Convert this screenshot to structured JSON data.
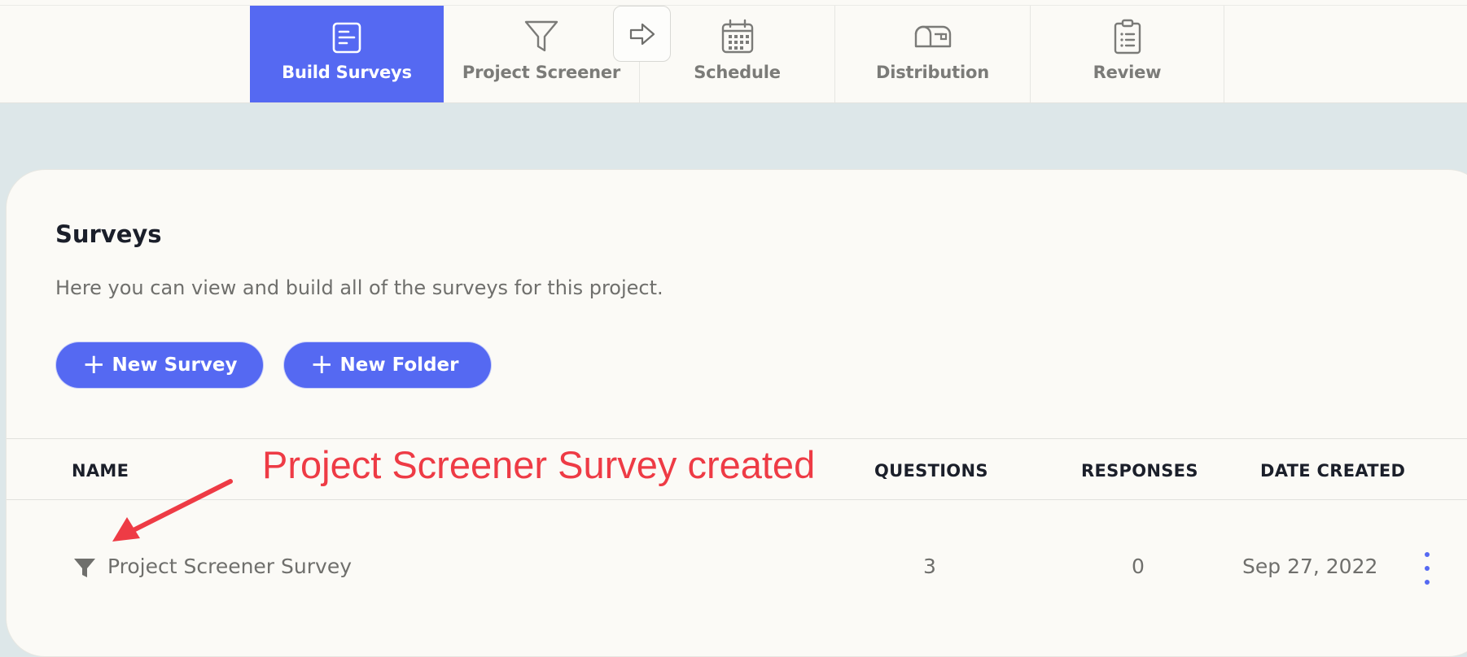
{
  "nav": {
    "tabs": [
      {
        "label": "Build Surveys",
        "icon": "document-icon",
        "active": true
      },
      {
        "label": "Project Screener",
        "icon": "filter-icon",
        "active": false
      },
      {
        "label": "Schedule",
        "icon": "calendar-icon",
        "active": false
      },
      {
        "label": "Distribution",
        "icon": "mailbox-icon",
        "active": false
      },
      {
        "label": "Review",
        "icon": "clipboard-icon",
        "active": false
      }
    ],
    "arrow_button_icon": "arrow-right-icon",
    "active_color": "#5569f2"
  },
  "surveys": {
    "title": "Surveys",
    "description": "Here you can view and build all of the surveys for this project.",
    "new_survey_label": "New Survey",
    "new_folder_label": "New Folder",
    "columns": [
      "NAME",
      "QUESTIONS",
      "RESPONSES",
      "DATE CREATED"
    ],
    "rows": [
      {
        "icon": "filter-icon",
        "name": "Project Screener Survey",
        "questions": "3",
        "responses": "0",
        "date_created": "Sep 27, 2022"
      }
    ]
  },
  "annotation": {
    "text": "Project Screener Survey created",
    "color": "#ee3b45"
  }
}
